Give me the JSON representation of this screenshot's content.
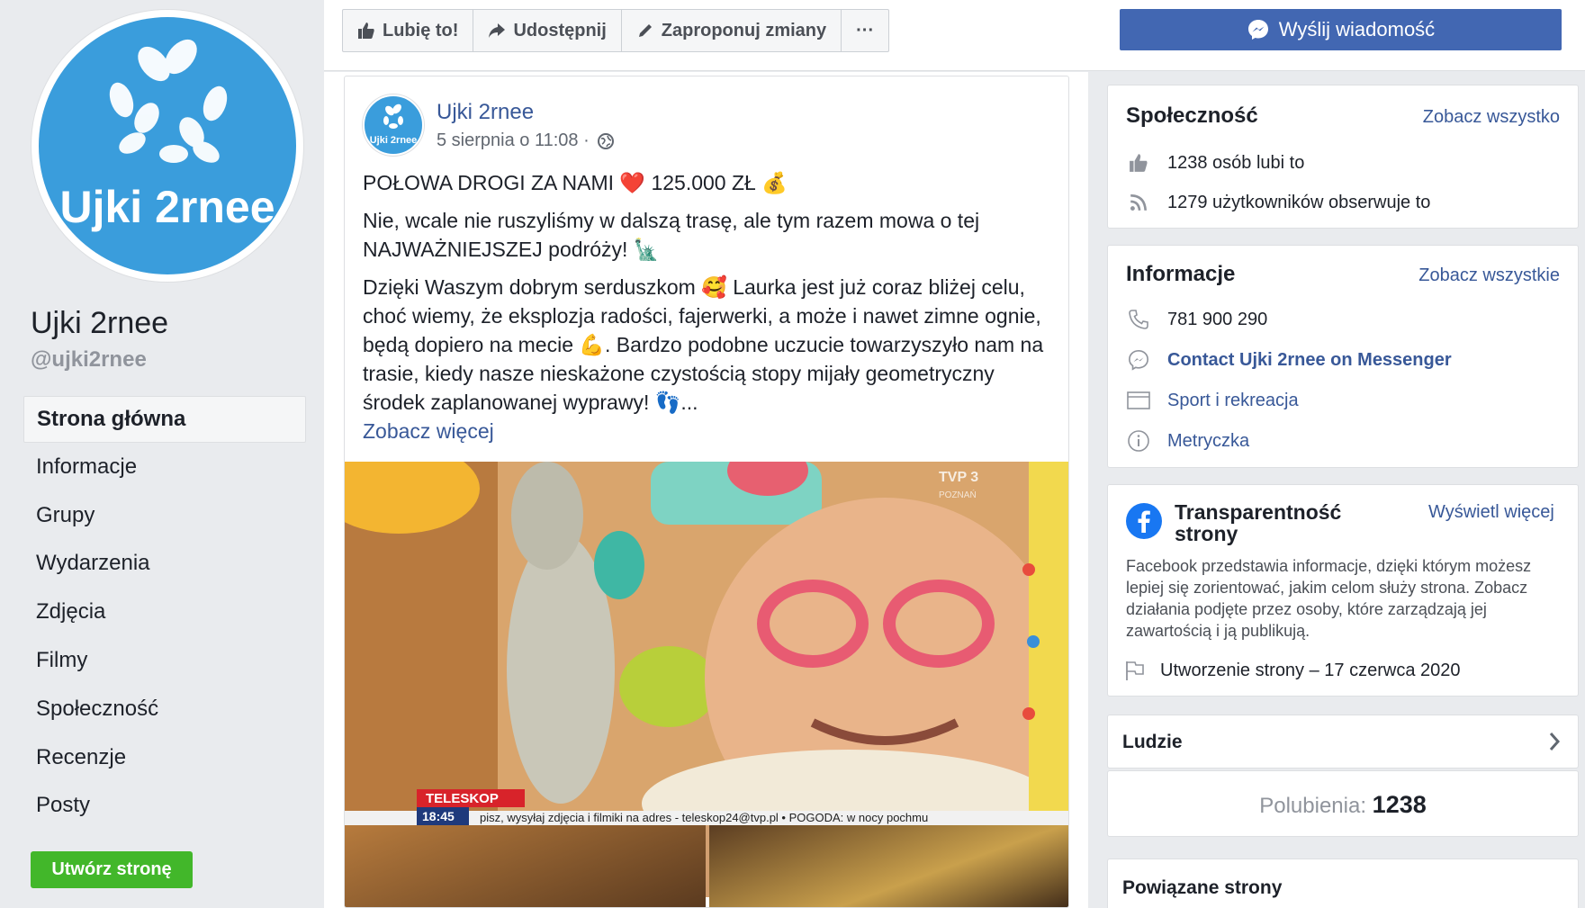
{
  "page": {
    "name": "Ujki 2rnee",
    "handle": "@ujki2rnee",
    "logo_text": "Ujki 2rnee"
  },
  "nav": {
    "items": [
      {
        "label": "Strona główna",
        "active": true
      },
      {
        "label": "Informacje"
      },
      {
        "label": "Grupy"
      },
      {
        "label": "Wydarzenia"
      },
      {
        "label": "Zdjęcia"
      },
      {
        "label": "Filmy"
      },
      {
        "label": "Społeczność"
      },
      {
        "label": "Recenzje"
      },
      {
        "label": "Posty"
      }
    ],
    "create_page": "Utwórz stronę"
  },
  "toolbar": {
    "like": "Lubię to!",
    "share": "Udostępnij",
    "suggest": "Zaproponuj zmiany",
    "more": "···",
    "message": "Wyślij wiadomość"
  },
  "post": {
    "author": "Ujki 2rnee",
    "time": "5 sierpnia o 11:08 ·",
    "line1": "POŁOWA DROGI ZA NAMI ❤️ 125.000 ZŁ 💰",
    "para2": "Nie, wcale nie ruszyliśmy w dalszą trasę, ale tym razem mowa o tej NAJWAŻNIEJSZEJ podróży! 🗽",
    "para3": "Dzięki Waszym dobrym serduszkom 🥰 Laurka jest już coraz bliżej celu, choć wiemy, że eksplozja radości, fajerwerki, a może i nawet zimne ognie, będą dopiero na mecie 💪. Bardzo podobne uczucie towarzyszyło nam na trasie, kiedy nasze nieskażone czystością stopy mijały geometryczny środek zaplanowanej wyprawy! 👣...",
    "see_more": "Zobacz więcej",
    "image_caption_brand": "TELESKOP",
    "image_caption_time": "18:45",
    "image_ticker": "pisz, wysyłaj zdjęcia i filmiki na adres - teleskop24@tvp.pl  •  POGODA: w nocy pochmu",
    "image_channel": "TVP 3",
    "image_channel_sub": "POZNAŃ"
  },
  "community": {
    "title": "Społeczność",
    "link": "Zobacz wszystko",
    "likes": "1238 osób lubi to",
    "follows": "1279 użytkowników obserwuje to"
  },
  "info": {
    "title": "Informacje",
    "link": "Zobacz wszystkie",
    "phone": "781 900 290",
    "messenger": "Contact Ujki 2rnee on Messenger",
    "category": "Sport i rekreacja",
    "about": "Metryczka"
  },
  "transparency": {
    "title": "Transparentność strony",
    "link": "Wyświetl więcej",
    "desc": "Facebook przedstawia informacje, dzięki którym możesz lepiej się zorientować, jakim celom służy strona. Zobacz działania podjęte przez osoby, które zarządzają jej zawartością i ją publikują.",
    "created": "Utworzenie strony – 17 czerwca 2020"
  },
  "people": {
    "title": "Ludzie",
    "likes_label": "Polubienia:",
    "likes_value": "1238"
  },
  "related": {
    "title": "Powiązane strony"
  },
  "colors": {
    "brand_blue": "#4267b2",
    "link": "#385898",
    "logo_bg": "#3a9ddc",
    "create_green": "#42b72a"
  }
}
